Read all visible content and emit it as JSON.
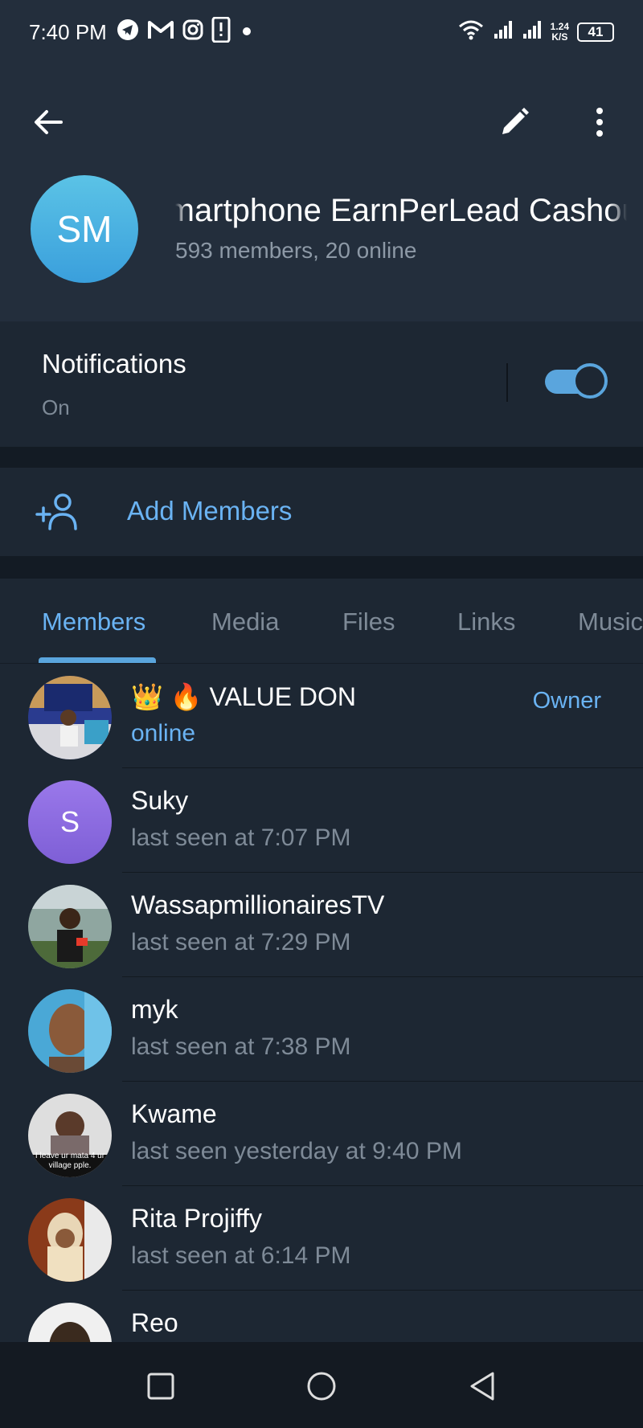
{
  "status_bar": {
    "time": "7:40 PM",
    "speed_value": "1.24",
    "speed_unit": "K/S",
    "battery": "41",
    "icons": [
      "telegram-icon",
      "gmail-icon",
      "instagram-icon",
      "phone-alert-icon",
      "dot-icon",
      "wifi-icon",
      "signal-icon",
      "signal-icon"
    ]
  },
  "header": {
    "group_initials": "SM",
    "group_title": "Smartphone EarnPerLead Cashout",
    "group_subtitle": "593 members, 20 online"
  },
  "notifications": {
    "title": "Notifications",
    "state": "On",
    "enabled": true
  },
  "add_members": {
    "label": "Add Members"
  },
  "tabs": [
    {
      "label": "Members",
      "active": true
    },
    {
      "label": "Media",
      "active": false
    },
    {
      "label": "Files",
      "active": false
    },
    {
      "label": "Links",
      "active": false
    },
    {
      "label": "Music",
      "active": false
    }
  ],
  "members": [
    {
      "name": "👑 🔥 VALUE DON",
      "status": "online",
      "role": "Owner"
    },
    {
      "name": "Suky",
      "status": "last seen at 7:07 PM",
      "initial": "S"
    },
    {
      "name": "WassapmillionairesTV",
      "status": "last seen at 7:29 PM"
    },
    {
      "name": "myk",
      "status": "last seen at 7:38 PM"
    },
    {
      "name": "Kwame",
      "status": "last seen yesterday at 9:40 PM",
      "photo_caption": "I leave ur mata 4 ur village pple."
    },
    {
      "name": "Rita Projiffy",
      "status": "last seen at 6:14 PM"
    },
    {
      "name": "Reo",
      "status": ""
    }
  ],
  "colors": {
    "accent": "#6ab3f3",
    "background": "#1d2733",
    "header": "#232e3c",
    "secondary_text": "#7e8a97"
  }
}
